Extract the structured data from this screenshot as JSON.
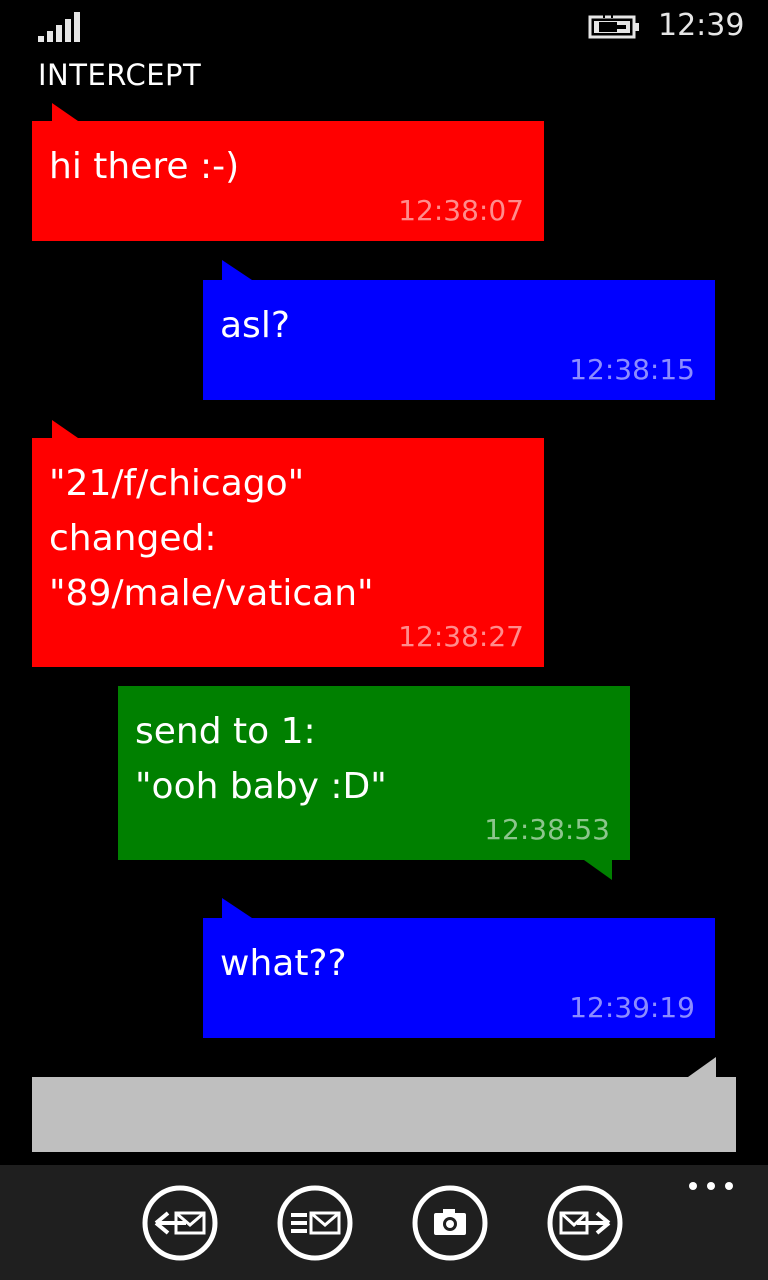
{
  "status_bar": {
    "time": "12:39",
    "signal_icon": "signal-strength-icon",
    "battery_icon": "battery-charging-icon"
  },
  "app": {
    "title": "INTERCEPT"
  },
  "messages": [
    {
      "text": "hi there :-)",
      "time": "12:38:07",
      "color": "#ff0000",
      "direction": "incoming"
    },
    {
      "text": "asl?",
      "time": "12:38:15",
      "color": "#0000ff",
      "direction": "outgoing"
    },
    {
      "text": "\"21/f/chicago\"\nchanged:\n\"89/male/vatican\"",
      "time": "12:38:27",
      "color": "#ff0000",
      "direction": "incoming"
    },
    {
      "text": "send to 1:\n\"ooh baby :D\"",
      "time": "12:38:53",
      "color": "#008000",
      "direction": "relay"
    },
    {
      "text": "what??",
      "time": "12:39:19",
      "color": "#0000ff",
      "direction": "outgoing"
    }
  ],
  "input": {
    "value": "",
    "background": "#bfbfbf"
  },
  "app_bar": {
    "buttons": [
      "receive-message-icon",
      "message-list-icon",
      "camera-icon",
      "send-receive-icon"
    ],
    "more_icon": "more-ellipsis-icon"
  }
}
